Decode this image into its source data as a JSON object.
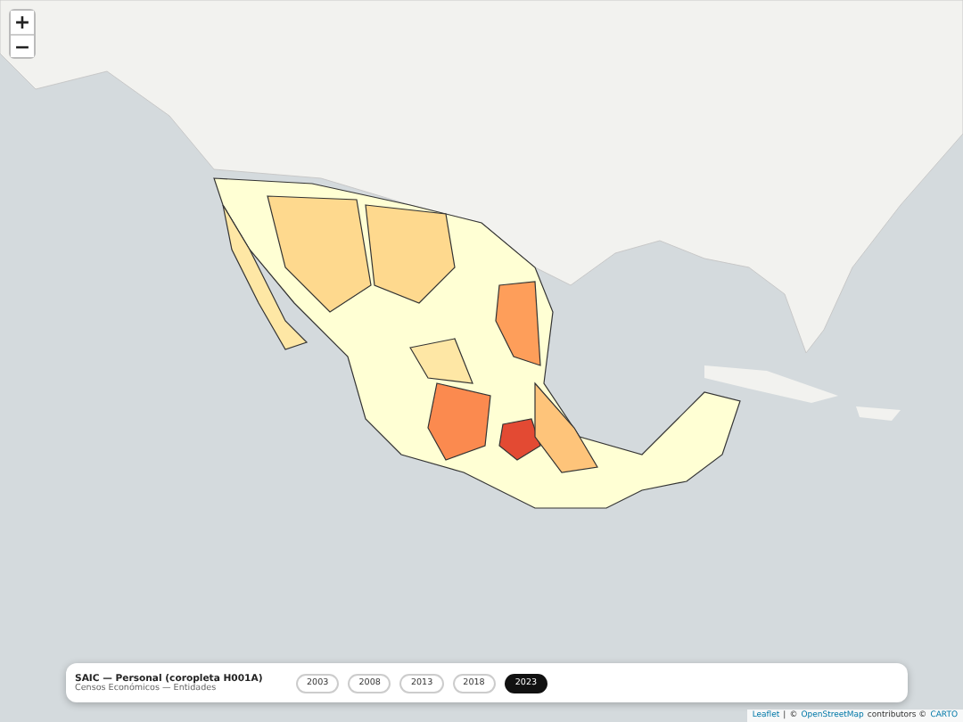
{
  "zoom_controls": [
    {
      "label": "+"
    },
    {
      "label": "−"
    }
  ],
  "panel": {
    "title": "SAIC — Personal (coropleta H001A)",
    "subtitle": "Censos Económicos — Entidades",
    "years": [
      {
        "label": "2003",
        "selected": false
      },
      {
        "label": "2008",
        "selected": false
      },
      {
        "label": "2013",
        "selected": false
      },
      {
        "label": "2018",
        "selected": false
      },
      {
        "label": "2023",
        "selected": true
      }
    ]
  },
  "attribution": {
    "links": [
      "Leaflet",
      "OpenStreetMap",
      "CARTO"
    ],
    "separator": "|",
    "copyright": "©",
    "suffix": "contributors ©"
  }
}
